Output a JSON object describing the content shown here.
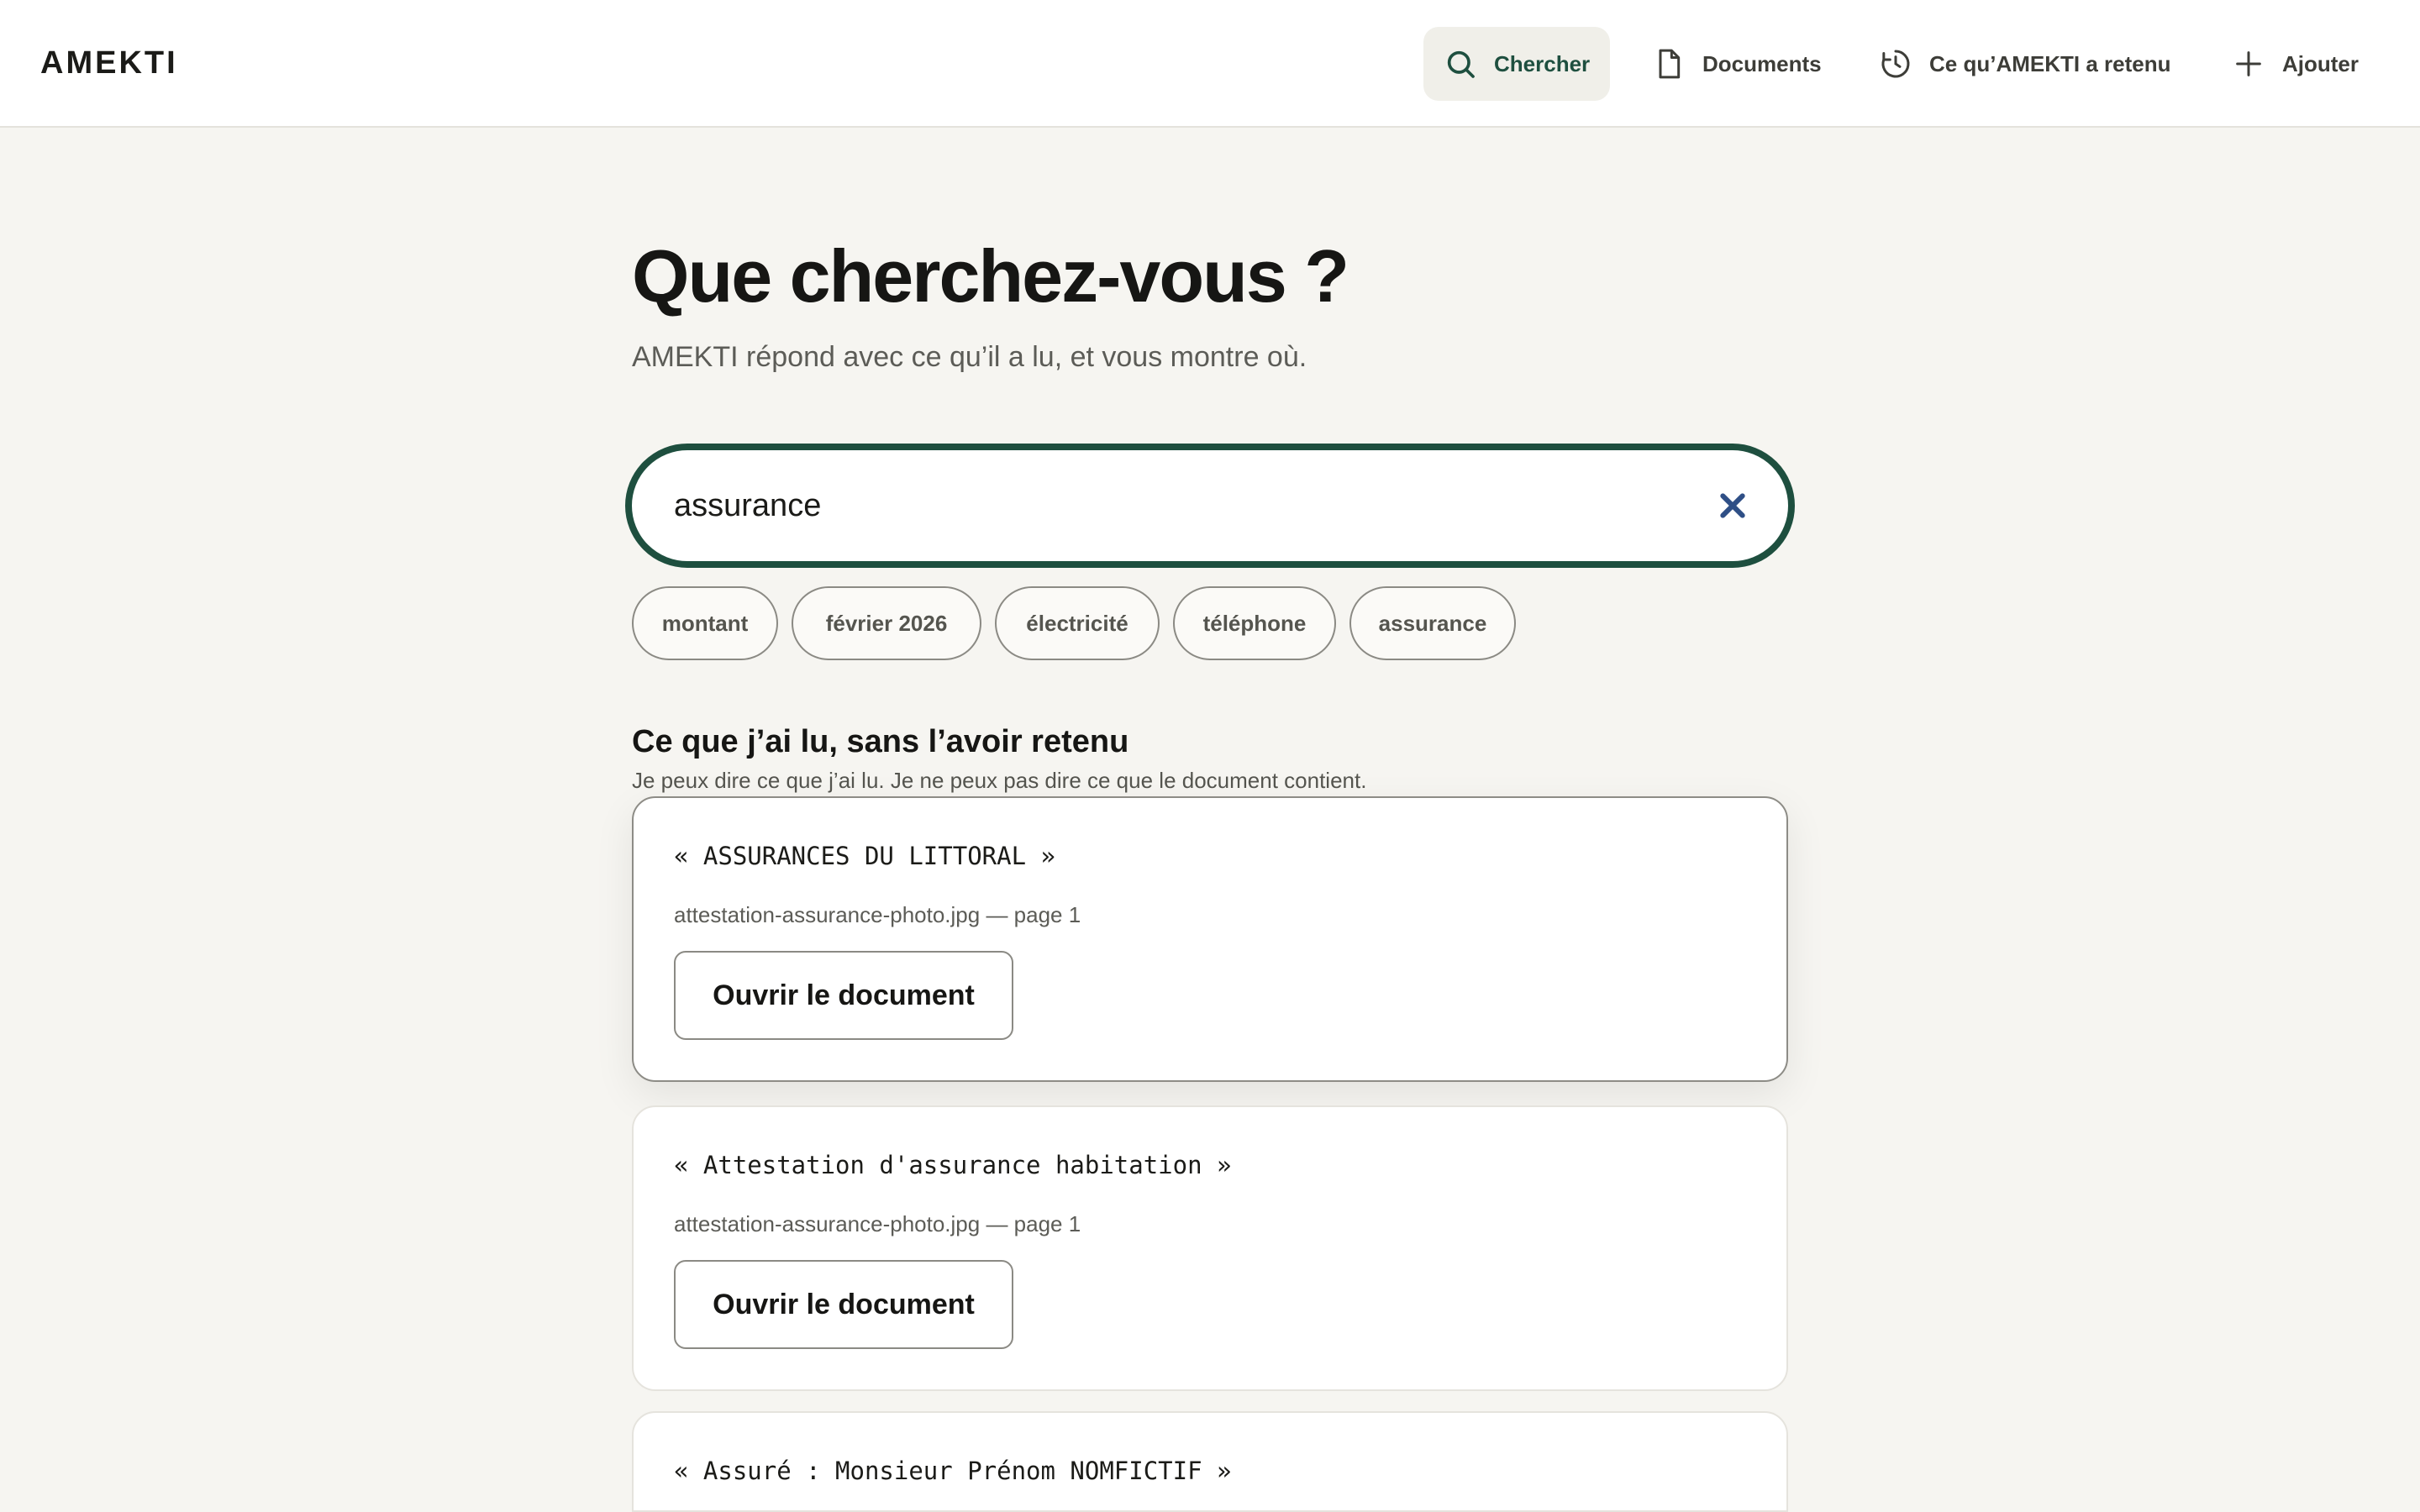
{
  "app": {
    "brand": "AMEKTI"
  },
  "nav": {
    "items": [
      {
        "label": "Chercher",
        "icon": "search-icon",
        "active": true
      },
      {
        "label": "Documents",
        "icon": "document-icon",
        "active": false
      },
      {
        "label": "Ce qu’AMEKTI a retenu",
        "icon": "history-icon",
        "active": false
      },
      {
        "label": "Ajouter",
        "icon": "plus-icon",
        "active": false
      }
    ]
  },
  "page": {
    "title": "Que cherchez-vous ?",
    "subtitle": "AMEKTI répond avec ce qu’il a lu, et vous montre où."
  },
  "search": {
    "value": "assurance",
    "placeholder": ""
  },
  "chips": [
    "montant",
    "février 2026",
    "électricité",
    "téléphone",
    "assurance"
  ],
  "results_section": {
    "title": "Ce que j’ai lu, sans l’avoir retenu",
    "subtitle": "Je peux dire ce que j’ai lu. Je ne peux pas dire ce que le document contient.",
    "open_label": "Ouvrir le document",
    "items": [
      {
        "quote": "« ASSURANCES DU LITTORAL »",
        "meta": "attestation-assurance-photo.jpg — page 1"
      },
      {
        "quote": "« Attestation d'assurance habitation »",
        "meta": "attestation-assurance-photo.jpg — page 1"
      },
      {
        "quote": "« Assuré : Monsieur Prénom NOMFICTIF »",
        "meta": ""
      }
    ]
  },
  "colors": {
    "accent": "#1e4f3f",
    "background": "#f6f5f1",
    "clear_icon": "#2f4f86"
  }
}
